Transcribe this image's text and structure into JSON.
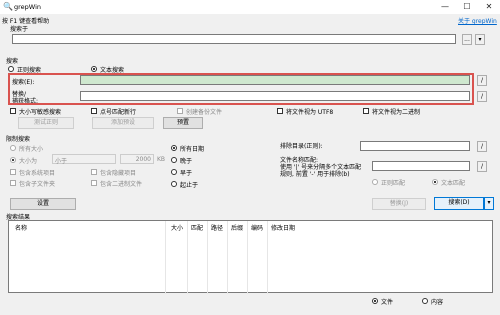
{
  "window": {
    "title": "grepWin",
    "minimize": "—",
    "maximize": "☐",
    "close": "✕"
  },
  "help": {
    "hint": "按 F1 键查看帮助",
    "about_link": "关于 grepWin"
  },
  "search_in": {
    "label": "搜索于",
    "value": "",
    "browse": "...",
    "dropdown": "▾"
  },
  "search": {
    "group_label": "搜索",
    "regex_label": "正则搜索",
    "text_label": "文本搜索",
    "search_label": "搜索(E):",
    "search_value": "",
    "replace_label_1": "替换/",
    "replace_label_2": "捕获格式:",
    "replace_value": "",
    "slash_1": "/",
    "slash_2": "/",
    "case_sensitive": "大小写敏感搜索",
    "dot_newline": "点号匹配新行",
    "backup": "创建备份文件",
    "utf8": "将文件视为 UTF8",
    "binary": "将文件视为二进制",
    "test_regex": "测试正则",
    "add_preset": "添加预设",
    "presets": "预置"
  },
  "limit": {
    "group_label": "限制搜索",
    "all_sizes": "所有大小",
    "size_is": "大小为",
    "size_op": "小于",
    "size_value": "2000",
    "size_unit": "KB",
    "all_dates": "所有日期",
    "newer": "晚于",
    "older": "早于",
    "between": "起止于",
    "include_system": "包含系统项目",
    "include_hidden": "包含隐藏项目",
    "include_subfolders": "包含子文件夹",
    "include_binary": "包含二进制文件",
    "exclude_dirs_label": "排除目录(正则):",
    "exclude_value": "",
    "filename_match_1": "文件名称匹配:",
    "filename_match_2": "使用 '|' 号来分隔多个文本匹配",
    "filename_match_3": "规则, 前置 '-' 用于排除(b)",
    "filename_value": "",
    "regex_match": "正则匹配",
    "text_match": "文本匹配",
    "slash_a": "/",
    "slash_b": "/"
  },
  "actions": {
    "settings": "设置",
    "replace": "替换(J)",
    "search": "搜索(D)",
    "search_dropdown": "▾"
  },
  "results": {
    "group_label": "搜索结果",
    "columns": [
      "名称",
      "大小",
      "匹配",
      "路径",
      "后缀",
      "编码",
      "修改日期"
    ],
    "show_files": "文件",
    "show_content": "内容"
  }
}
